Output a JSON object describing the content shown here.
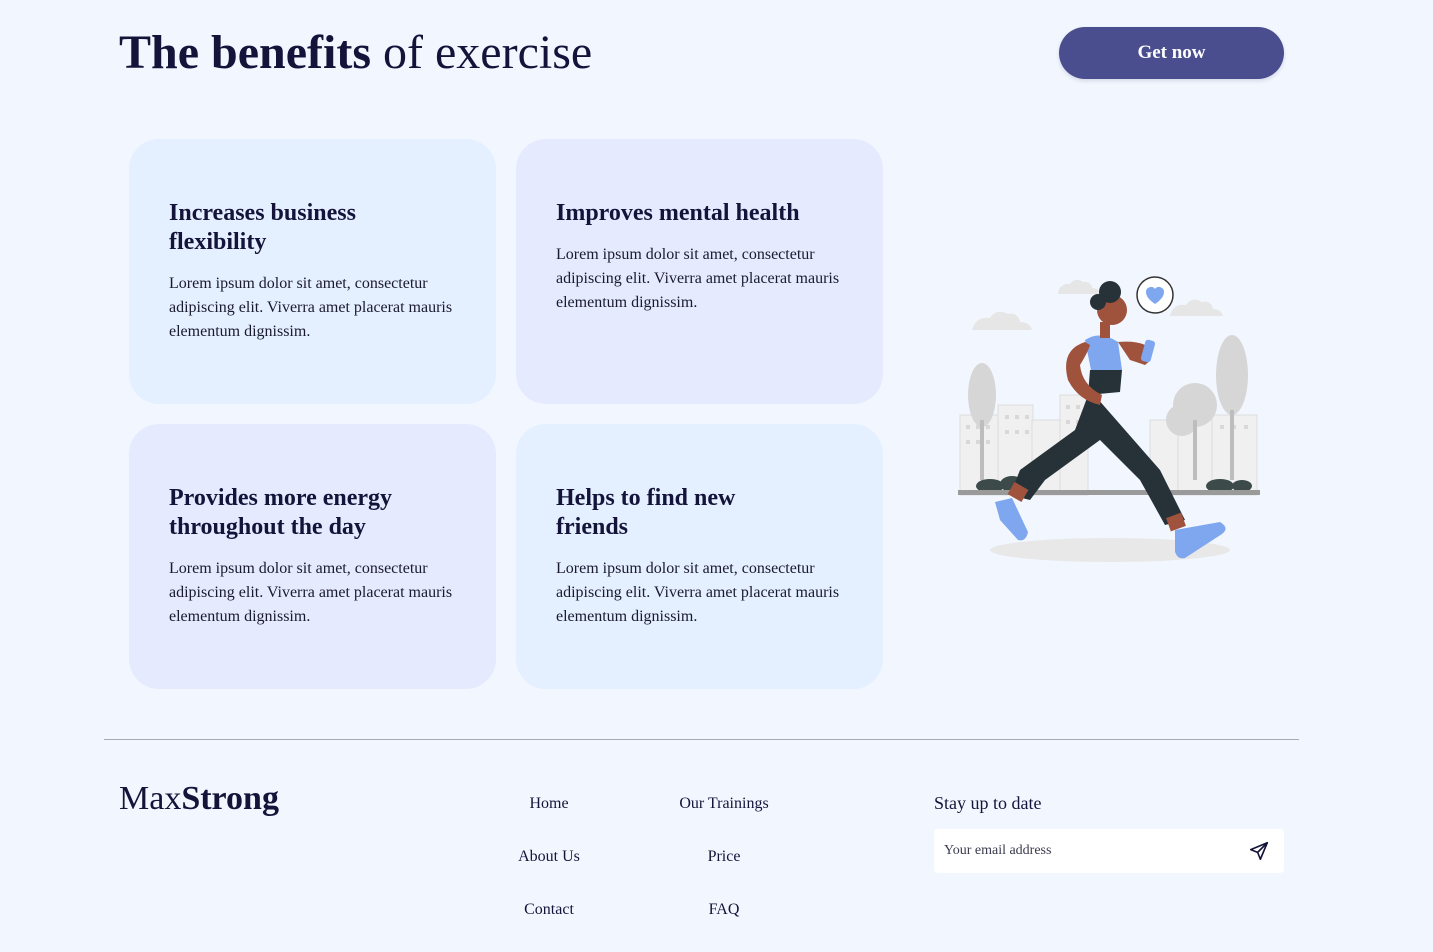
{
  "header": {
    "title_bold": "The benefits",
    "title_rest": " of exercise",
    "cta_label": "Get now"
  },
  "cards": [
    {
      "title": "Increases business flexibility",
      "body": "Lorem ipsum dolor sit amet, consectetur adipiscing elit. Viverra amet placerat mauris elementum dignissim."
    },
    {
      "title": "Improves mental health",
      "body": "Lorem ipsum dolor sit amet, consectetur adipiscing elit. Viverra amet placerat mauris elementum dignissim."
    },
    {
      "title": "Provides more energy throughout the day",
      "body": "Lorem ipsum dolor sit amet, consectetur adipiscing elit. Viverra amet placerat mauris elementum dignissim."
    },
    {
      "title": "Helps to find new friends",
      "body": "Lorem ipsum dolor sit amet, consectetur adipiscing elit. Viverra amet placerat mauris elementum dignissim."
    }
  ],
  "illustration": {
    "icon": "running-woman-illustration"
  },
  "footer": {
    "logo_light": "Max",
    "logo_bold": "Strong",
    "links": [
      "Home",
      "Our Trainings",
      "About Us",
      "Price",
      "Contact",
      "FAQ"
    ],
    "newsletter_heading": "Stay up to date",
    "email_placeholder": "Your email address",
    "send_icon": "send-icon"
  },
  "colors": {
    "background": "#f2f7ff",
    "primary": "#4a4e8e",
    "text": "#14143a",
    "card_blue": "#e4efff",
    "card_lavender": "#e6eaff",
    "accent_shoe": "#7ea7f0"
  }
}
